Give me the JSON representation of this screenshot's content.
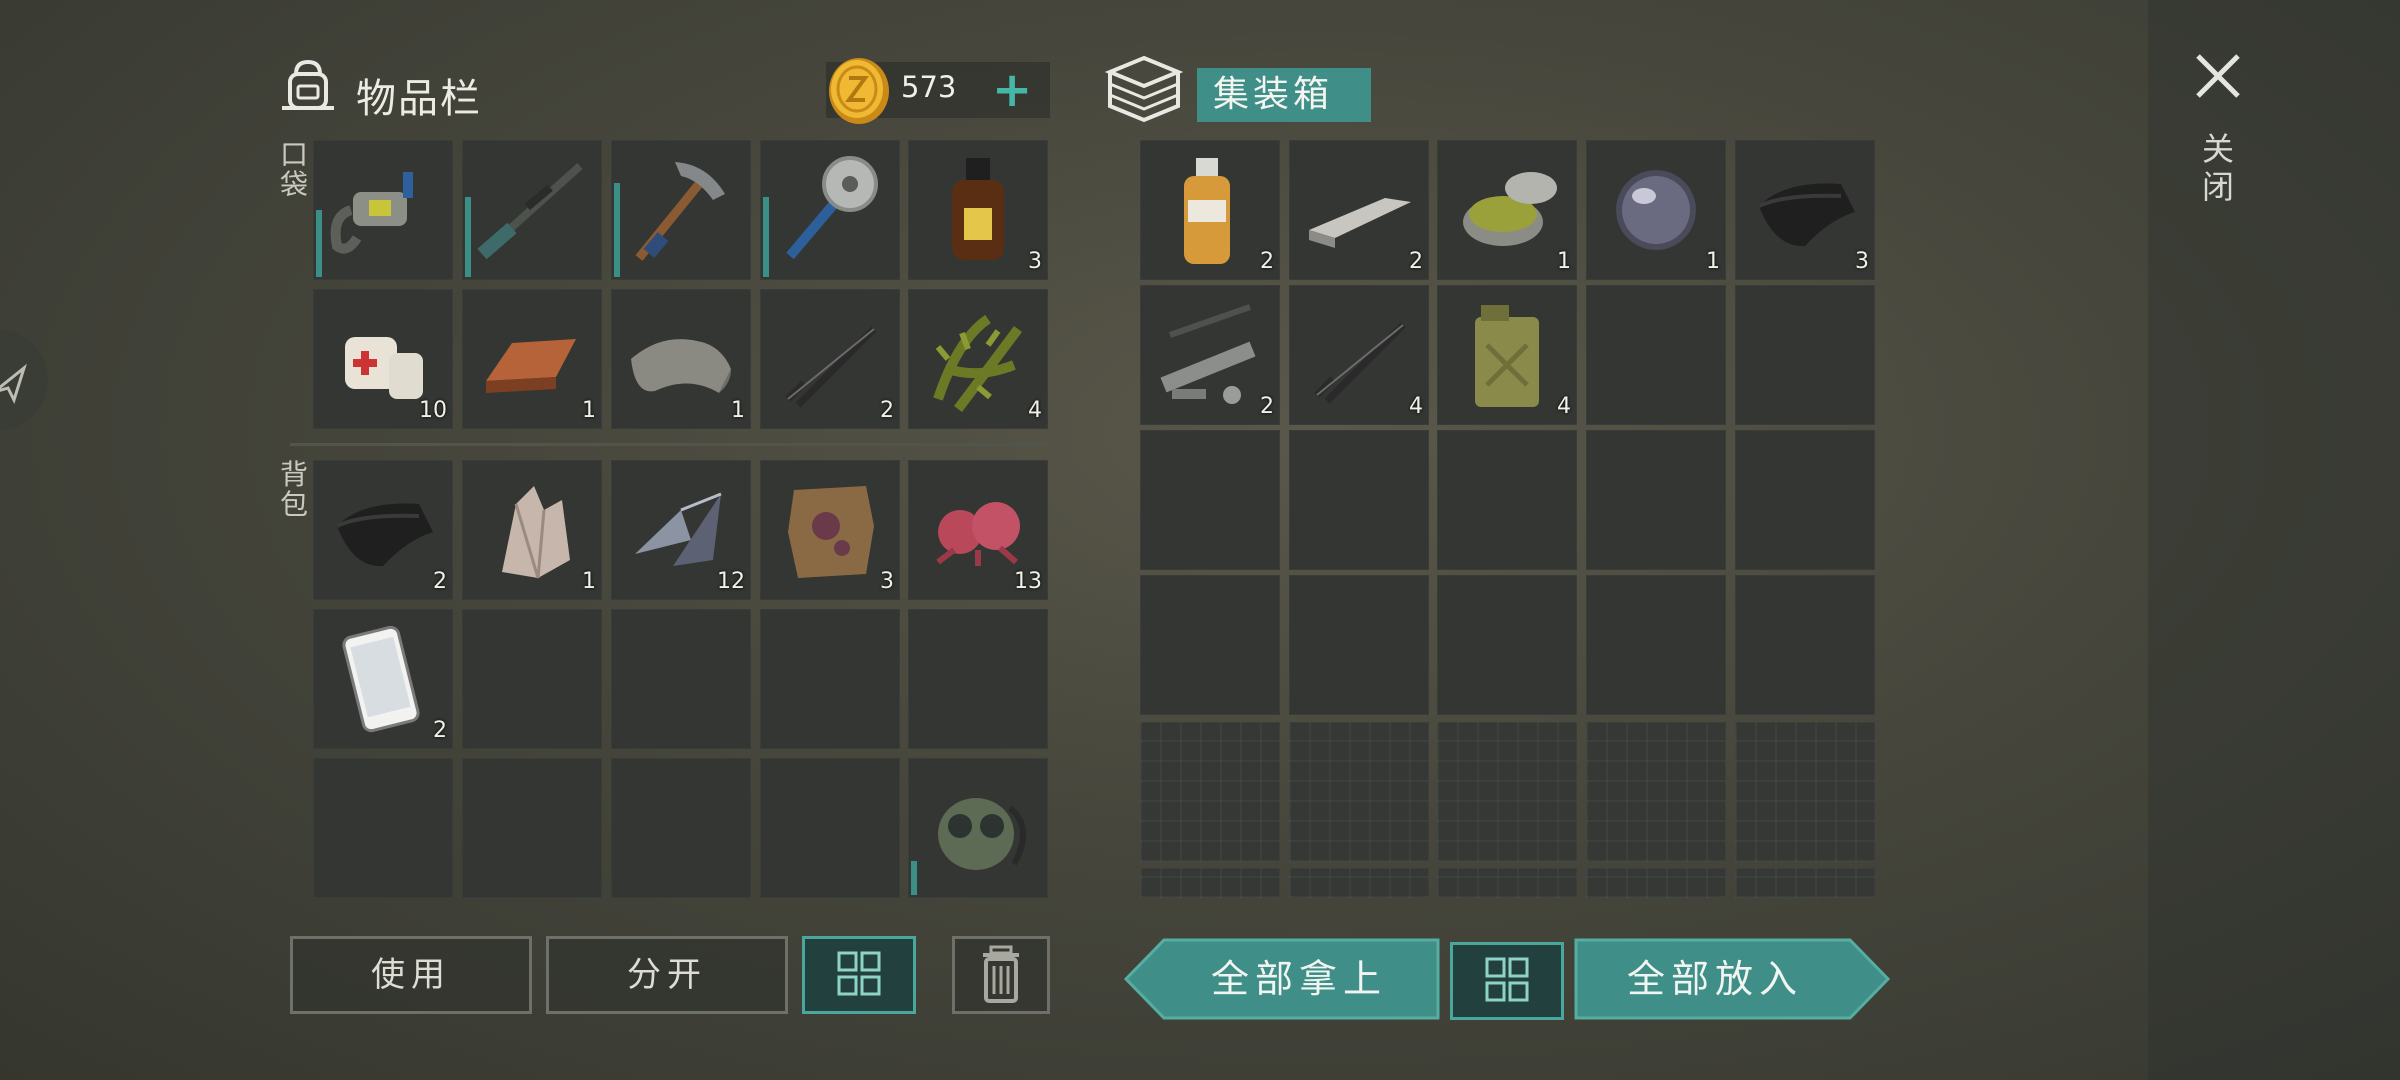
{
  "inventory": {
    "title": "物品栏",
    "coins": "573",
    "add_label": "+",
    "section_pockets": "口袋",
    "section_backpack": "背包",
    "pocket_slots": [
      {
        "icon": "chainsaw-icon",
        "qty": "",
        "durability": 0.5
      },
      {
        "icon": "sniper-rifle-icon",
        "qty": "",
        "durability": 0.6
      },
      {
        "icon": "pickaxe-icon",
        "qty": "",
        "durability": 0.7
      },
      {
        "icon": "sawblade-mace-icon",
        "qty": "",
        "durability": 0.6
      },
      {
        "icon": "bottle-icon",
        "qty": "3"
      },
      {
        "icon": "bandage-icon",
        "qty": "10"
      },
      {
        "icon": "copper-ingot-icon",
        "qty": "1"
      },
      {
        "icon": "fabric-icon",
        "qty": "1"
      },
      {
        "icon": "spring-icon",
        "qty": "2"
      },
      {
        "icon": "plant-fiber-icon",
        "qty": "4"
      }
    ],
    "backpack_slots": [
      {
        "icon": "leather-icon",
        "qty": "2"
      },
      {
        "icon": "crystal-icon",
        "qty": "1"
      },
      {
        "icon": "metal-shards-icon",
        "qty": "12"
      },
      {
        "icon": "animal-hide-icon",
        "qty": "3"
      },
      {
        "icon": "red-berries-icon",
        "qty": "13"
      },
      {
        "icon": "smartphone-icon",
        "qty": "2"
      },
      {
        "icon": "",
        "qty": ""
      },
      {
        "icon": "",
        "qty": ""
      },
      {
        "icon": "",
        "qty": ""
      },
      {
        "icon": "",
        "qty": ""
      },
      {
        "icon": "",
        "qty": ""
      },
      {
        "icon": "",
        "qty": ""
      },
      {
        "icon": "",
        "qty": ""
      },
      {
        "icon": "",
        "qty": ""
      },
      {
        "icon": "gas-mask-icon",
        "qty": "",
        "durability": 0.25
      }
    ],
    "buttons": {
      "use": "使用",
      "split": "分开"
    }
  },
  "container": {
    "title": "集装箱",
    "slots": [
      {
        "icon": "peroxide-bottle-icon",
        "qty": "2"
      },
      {
        "icon": "metal-bar-icon",
        "qty": "2"
      },
      {
        "icon": "resin-jar-icon",
        "qty": "1"
      },
      {
        "icon": "lens-icon",
        "qty": "1"
      },
      {
        "icon": "leather-icon",
        "qty": "3"
      },
      {
        "icon": "pipe-parts-icon",
        "qty": "2"
      },
      {
        "icon": "spring-icon",
        "qty": "4"
      },
      {
        "icon": "jerrycan-icon",
        "qty": "4"
      }
    ],
    "take_all": "全部拿上",
    "put_all": "全部放入"
  },
  "close_label": "关闭",
  "colors": {
    "accent": "#3f8f88",
    "accent_border": "#4aa79b",
    "slot_bg": "#333632",
    "coin": "#e0a32a"
  }
}
